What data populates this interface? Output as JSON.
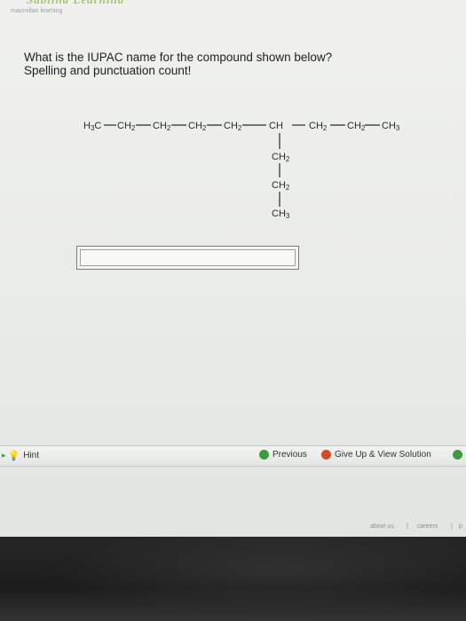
{
  "app": {
    "logo_text": "Sapling Learning",
    "logo_sub": "macmillan learning"
  },
  "question": {
    "line1": "What is the IUPAC name for the compound shown below?",
    "line2": "Spelling and punctuation count!"
  },
  "structure": {
    "main_chain": [
      "H3C",
      "CH2",
      "CH2",
      "CH2",
      "CH2",
      "CH",
      "CH2",
      "CH2",
      "CH3"
    ],
    "branch": [
      "CH2",
      "CH2",
      "CH3"
    ]
  },
  "answer": {
    "value": "",
    "placeholder": ""
  },
  "toolbar": {
    "hint_label": "Hint",
    "previous_label": "Previous",
    "giveup_label": "Give Up & View Solution"
  },
  "footer": {
    "links": [
      "about us",
      "careers",
      "p"
    ]
  },
  "colors": {
    "hint_icon": "#f2c230",
    "previous_icon": "#3d9a3d",
    "giveup_icon": "#d24a2c",
    "check_icon": "#3d9a3d"
  }
}
